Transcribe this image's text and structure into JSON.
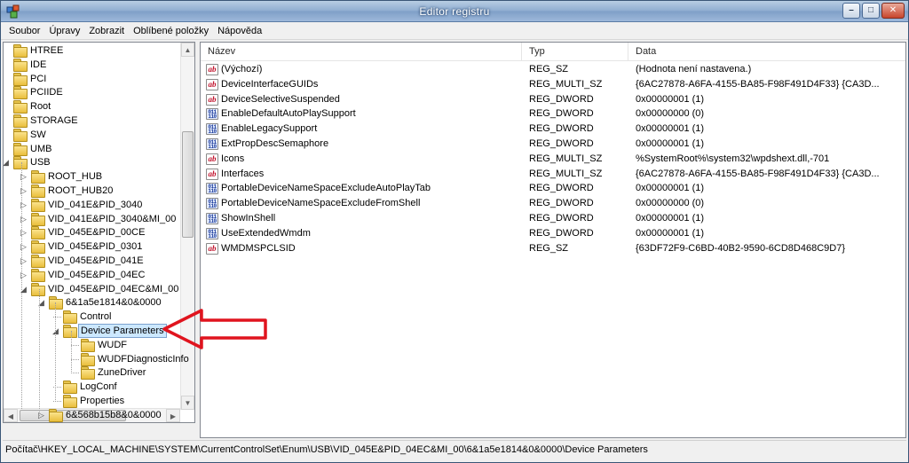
{
  "window": {
    "title": "Editor registru",
    "minimize": "–",
    "maximize": "□",
    "close": "✕"
  },
  "menu": [
    {
      "label": "Soubor"
    },
    {
      "label": "Úpravy"
    },
    {
      "label": "Zobrazit"
    },
    {
      "label": "Oblíbené položky"
    },
    {
      "label": "Nápověda"
    }
  ],
  "tree": {
    "items": [
      {
        "label": "HTREE"
      },
      {
        "label": "IDE"
      },
      {
        "label": "PCI"
      },
      {
        "label": "PCIIDE"
      },
      {
        "label": "Root"
      },
      {
        "label": "STORAGE"
      },
      {
        "label": "SW"
      },
      {
        "label": "UMB"
      },
      {
        "label": "USB"
      },
      {
        "label": "ROOT_HUB"
      },
      {
        "label": "ROOT_HUB20"
      },
      {
        "label": "VID_041E&PID_3040"
      },
      {
        "label": "VID_041E&PID_3040&MI_00"
      },
      {
        "label": "VID_045E&PID_00CE"
      },
      {
        "label": "VID_045E&PID_0301"
      },
      {
        "label": "VID_045E&PID_041E"
      },
      {
        "label": "VID_045E&PID_04EC"
      },
      {
        "label": "VID_045E&PID_04EC&MI_00"
      },
      {
        "label": "6&1a5e1814&0&0000"
      },
      {
        "label": "Control"
      },
      {
        "label": "Device Parameters"
      },
      {
        "label": "WUDF"
      },
      {
        "label": "WUDFDiagnosticInfo"
      },
      {
        "label": "ZuneDriver"
      },
      {
        "label": "LogConf"
      },
      {
        "label": "Properties"
      },
      {
        "label": "6&568b15b8&0&0000"
      }
    ]
  },
  "list": {
    "columns": [
      "Název",
      "Typ",
      "Data"
    ],
    "rows": [
      {
        "icon": "string-value-icon",
        "name": "(Výchozí)",
        "type": "REG_SZ",
        "data": "(Hodnota není nastavena.)"
      },
      {
        "icon": "string-value-icon",
        "name": "DeviceInterfaceGUIDs",
        "type": "REG_MULTI_SZ",
        "data": "{6AC27878-A6FA-4155-BA85-F98F491D4F33} {CA3D..."
      },
      {
        "icon": "string-value-icon",
        "name": "DeviceSelectiveSuspended",
        "type": "REG_DWORD",
        "data": "0x00000001 (1)"
      },
      {
        "icon": "dword-value-icon",
        "name": "EnableDefaultAutoPlaySupport",
        "type": "REG_DWORD",
        "data": "0x00000000 (0)"
      },
      {
        "icon": "dword-value-icon",
        "name": "EnableLegacySupport",
        "type": "REG_DWORD",
        "data": "0x00000001 (1)"
      },
      {
        "icon": "dword-value-icon",
        "name": "ExtPropDescSemaphore",
        "type": "REG_DWORD",
        "data": "0x00000001 (1)"
      },
      {
        "icon": "string-value-icon",
        "name": "Icons",
        "type": "REG_MULTI_SZ",
        "data": "%SystemRoot%\\system32\\wpdshext.dll,-701"
      },
      {
        "icon": "string-value-icon",
        "name": "Interfaces",
        "type": "REG_MULTI_SZ",
        "data": "{6AC27878-A6FA-4155-BA85-F98F491D4F33} {CA3D..."
      },
      {
        "icon": "dword-value-icon",
        "name": "PortableDeviceNameSpaceExcludeAutoPlayTab",
        "type": "REG_DWORD",
        "data": "0x00000001 (1)"
      },
      {
        "icon": "dword-value-icon",
        "name": "PortableDeviceNameSpaceExcludeFromShell",
        "type": "REG_DWORD",
        "data": "0x00000000 (0)"
      },
      {
        "icon": "dword-value-icon",
        "name": "ShowInShell",
        "type": "REG_DWORD",
        "data": "0x00000001 (1)"
      },
      {
        "icon": "dword-value-icon",
        "name": "UseExtendedWmdm",
        "type": "REG_DWORD",
        "data": "0x00000001 (1)"
      },
      {
        "icon": "string-value-icon",
        "name": "WMDMSPCLSID",
        "type": "REG_SZ",
        "data": "{63DF72F9-C6BD-40B2-9590-6CD8D468C9D7}"
      }
    ]
  },
  "statusbar": {
    "path": "Počítač\\HKEY_LOCAL_MACHINE\\SYSTEM\\CurrentControlSet\\Enum\\USB\\VID_045E&PID_04EC&MI_00\\6&1a5e1814&0&0000\\Device Parameters"
  },
  "colors": {
    "annotation_arrow": "#e0141e",
    "selection": "#cce8ff"
  }
}
